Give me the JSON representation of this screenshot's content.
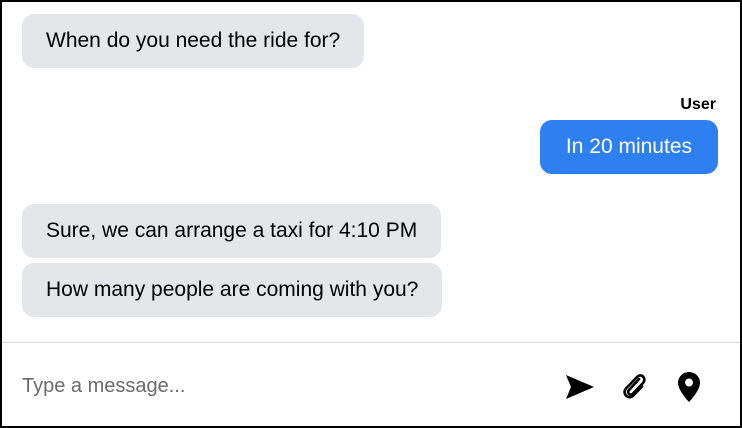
{
  "conversation": {
    "messages": [
      {
        "sender": "bot",
        "text": "When do you need the ride for?"
      },
      {
        "sender": "user",
        "sender_label": "User",
        "text": "In 20 minutes"
      },
      {
        "sender": "bot",
        "text": "Sure, we can arrange a taxi for 4:10 PM"
      },
      {
        "sender": "bot",
        "text": "How many people are coming with you?"
      }
    ]
  },
  "composer": {
    "placeholder": "Type a message...",
    "value": "",
    "icons": [
      "send-icon",
      "paperclip-icon",
      "location-pin-icon"
    ]
  },
  "colors": {
    "bot_bubble": "#e4e6ea",
    "user_bubble": "#2e7ff0",
    "user_text": "#ffffff",
    "border": "#000000"
  }
}
